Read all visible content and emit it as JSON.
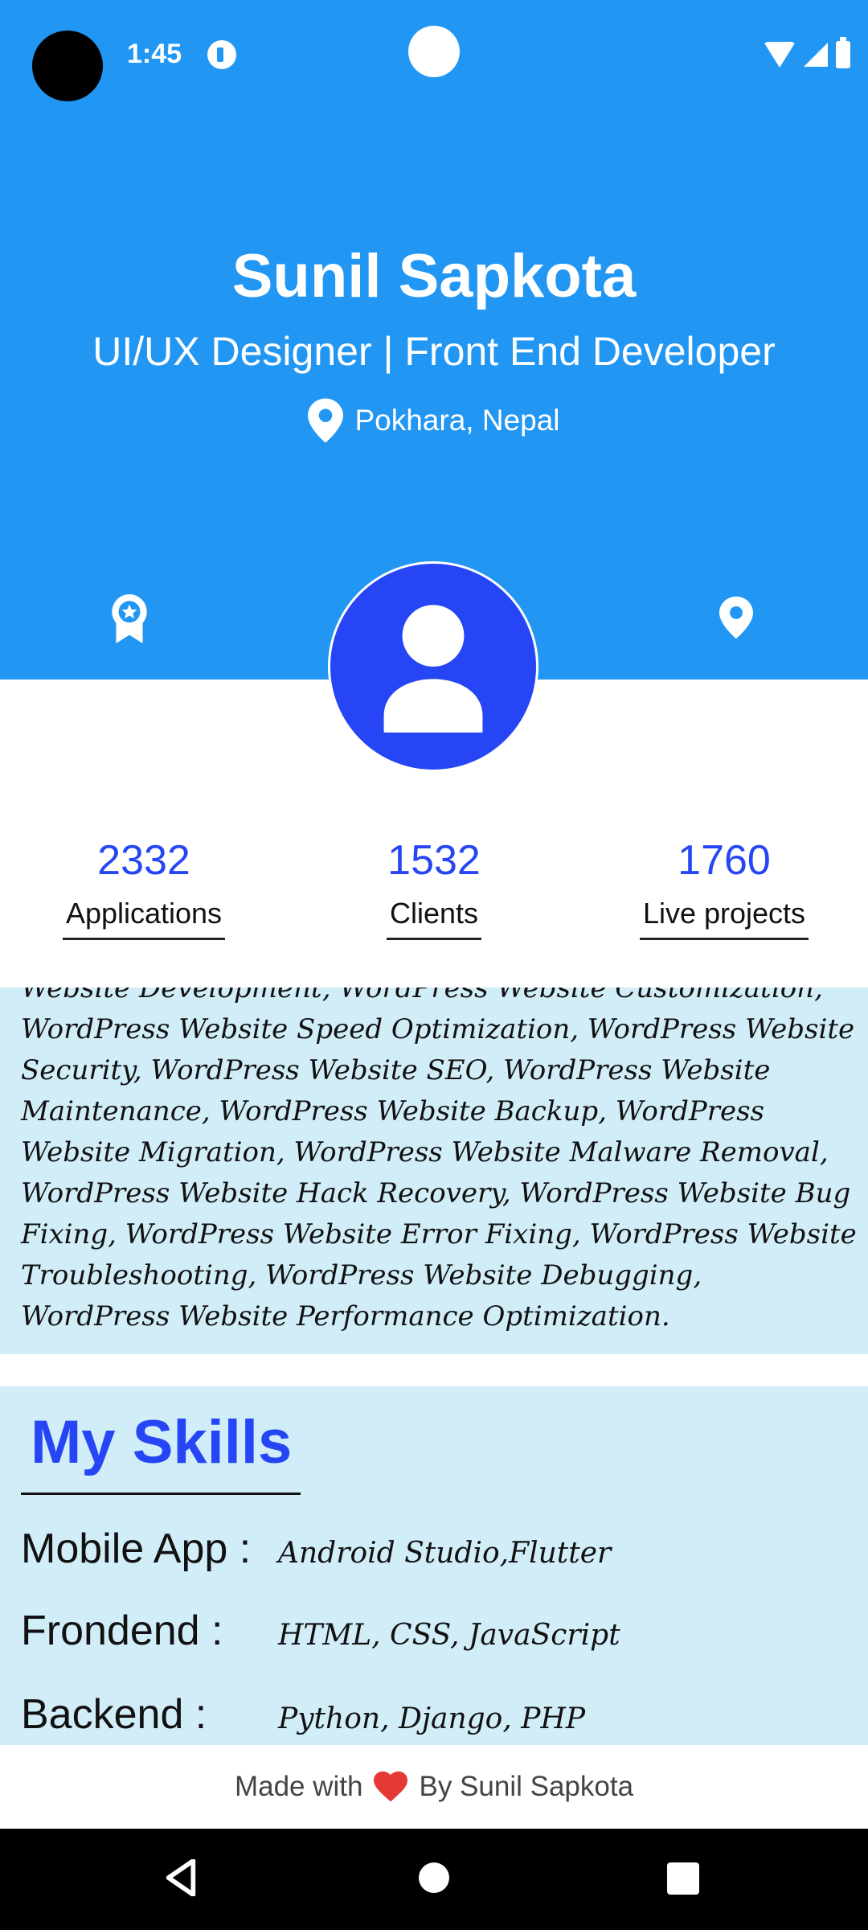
{
  "status_bar": {
    "time": "1:45"
  },
  "profile": {
    "name": "Sunil Sapkota",
    "title": "UI/UX Designer | Front End Developer",
    "location": "Pokhara, Nepal"
  },
  "stats": [
    {
      "value": "2332",
      "label": "Applications"
    },
    {
      "value": "1532",
      "label": "Clients"
    },
    {
      "value": "1760",
      "label": "Live projects"
    }
  ],
  "description": "Website Development, WordPress Website Customization, WordPress Website Speed Optimization, WordPress Website Security, WordPress Website SEO, WordPress Website Maintenance, WordPress Website Backup, WordPress Website Migration, WordPress Website Malware Removal, WordPress Website Hack Recovery, WordPress Website Bug Fixing, WordPress Website Error Fixing, WordPress Website Troubleshooting, WordPress Website Debugging, WordPress Website Performance Optimization.",
  "skills": {
    "title": "My Skills",
    "items": [
      {
        "label": "Mobile App :",
        "value": "Android Studio,Flutter"
      },
      {
        "label": "Frondend :",
        "value": "HTML, CSS, JavaScript"
      },
      {
        "label": "Backend :",
        "value": "Python, Django, PHP"
      }
    ]
  },
  "footer": {
    "made_with": "Made with",
    "by": "By Sunil Sapkota"
  },
  "colors": {
    "header": "#2196F3",
    "accent": "#2646F5",
    "section_bg": "#D1EDF8",
    "heart": "#E53935"
  },
  "icons": [
    "award-icon",
    "location-pin-icon",
    "person-icon",
    "heart-icon",
    "back-icon",
    "home-icon",
    "recents-icon"
  ]
}
